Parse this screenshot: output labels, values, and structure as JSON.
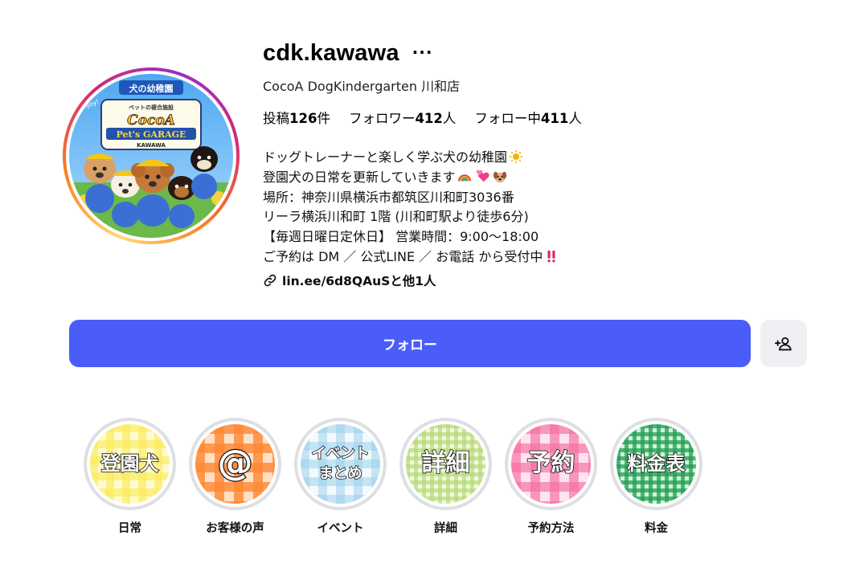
{
  "profile": {
    "username": "cdk.kawawa",
    "more_icon": "···",
    "fullname": "CocoA DogKindergarten 川和店",
    "stats": {
      "posts_label": "投稿",
      "posts_value": "126",
      "posts_unit": "件",
      "followers_label": "フォロワー",
      "followers_value": "412",
      "followers_unit": "人",
      "following_label": "フォロー中",
      "following_value": "411",
      "following_unit": "人"
    },
    "bio": [
      "ドッグトレーナーと楽しく学ぶ犬の幼稚園",
      "登園犬の日常を更新していきます",
      "場所：神奈川県横浜市都筑区川和町3036番",
      "リーラ横浜川和町 1階 (川和町駅より徒歩6分)",
      "【毎週日曜日定休日】 営業時間：9:00〜18:00",
      "ご予約は DM ／ 公式LINE ／ お電話 から受付中"
    ],
    "link": "lin.ee/6d8QAuSと他1人",
    "avatar": {
      "banner_top": "犬の幼稚園",
      "banner_sub": "ペットの複合施設",
      "brand": "CocoA",
      "brand_sub": "Pet's GARAGE",
      "location": "KAWAWA",
      "side_text": "enjoy!"
    }
  },
  "actions": {
    "follow_label": "フォロー",
    "add_user_icon": "add-user-icon"
  },
  "highlights": [
    {
      "cover_text": "登園犬",
      "label": "日常"
    },
    {
      "cover_text": "@",
      "label": "お客様の声"
    },
    {
      "cover_text_line1": "イベント",
      "cover_text_line2": "まとめ",
      "label": "イベント"
    },
    {
      "cover_text": "詳細",
      "label": "詳細"
    },
    {
      "cover_text": "予約",
      "label": "予約方法"
    },
    {
      "cover_text": "料金表",
      "label": "料金"
    }
  ],
  "colors": {
    "follow_button": "#4a5df9",
    "secondary_button": "#eff0f4",
    "highlight_ring": "#dedfe3"
  }
}
